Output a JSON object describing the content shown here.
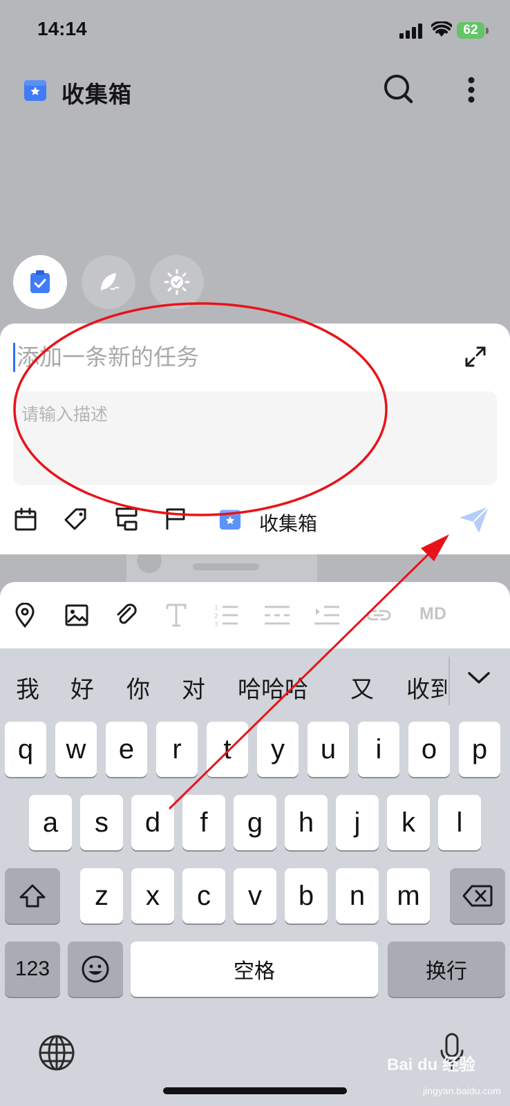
{
  "status_bar": {
    "time": "14:14",
    "battery": "62"
  },
  "header": {
    "title": "收集箱"
  },
  "quick_add": {
    "title_placeholder": "添加一条新的任务",
    "description_placeholder": "请输入描述",
    "project_label": "收集箱"
  },
  "editor_toolbar": {
    "md_label": "MD"
  },
  "keyboard": {
    "candidates": [
      "我",
      "好",
      "你",
      "对",
      "哈哈哈",
      "又",
      "收到"
    ],
    "row1": [
      "q",
      "w",
      "e",
      "r",
      "t",
      "y",
      "u",
      "i",
      "o",
      "p"
    ],
    "row2": [
      "a",
      "s",
      "d",
      "f",
      "g",
      "h",
      "j",
      "k",
      "l"
    ],
    "row3": [
      "z",
      "x",
      "c",
      "v",
      "b",
      "n",
      "m"
    ],
    "key_123": "123",
    "space": "空格",
    "return": "换行"
  },
  "watermark": {
    "brand": "Bai du 经验",
    "url": "jingyan.baidu.com"
  },
  "colors": {
    "accent": "#3f7cf6",
    "annotation_red": "#e8131a",
    "battery": "#64c466"
  }
}
